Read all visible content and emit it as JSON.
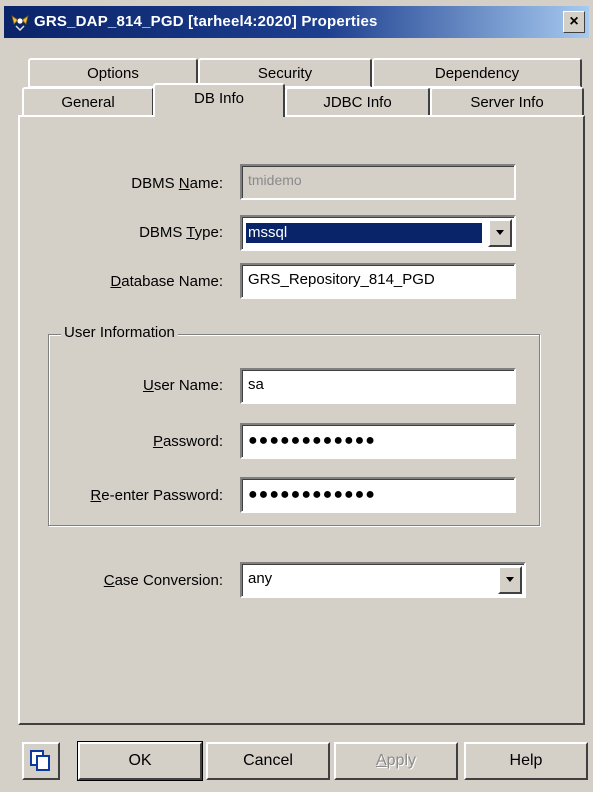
{
  "window": {
    "title": "GRS_DAP_814_PGD [tarheel4:2020] Properties",
    "close_glyph": "×"
  },
  "tabs_back": [
    {
      "label": "Options"
    },
    {
      "label": "Security"
    },
    {
      "label": "Dependency"
    }
  ],
  "tabs_front": [
    {
      "label": "General"
    },
    {
      "label": "DB Info",
      "active": true
    },
    {
      "label": "JDBC Info"
    },
    {
      "label": "Server Info"
    }
  ],
  "form": {
    "dbms_name": {
      "label_pre": "DBMS ",
      "label_u": "N",
      "label_post": "ame:",
      "value": "tmidemo"
    },
    "dbms_type": {
      "label_pre": "DBMS ",
      "label_u": "T",
      "label_post": "ype:",
      "value": "mssql"
    },
    "database_name": {
      "label_pre": "",
      "label_u": "D",
      "label_post": "atabase Name:",
      "value": "GRS_Repository_814_PGD"
    },
    "user_info_title": "User Information",
    "user_name": {
      "label_pre": "",
      "label_u": "U",
      "label_post": "ser Name:",
      "value": "sa"
    },
    "password": {
      "label_pre": "",
      "label_u": "P",
      "label_post": "assword:",
      "value": "●●●●●●●●●●●●"
    },
    "reenter_password": {
      "label_pre": "",
      "label_u": "R",
      "label_post": "e-enter Password:",
      "value": "●●●●●●●●●●●●"
    },
    "case_conversion": {
      "label_pre": "",
      "label_u": "C",
      "label_post": "ase Conversion:",
      "value": "any"
    }
  },
  "buttons": {
    "ok": "OK",
    "cancel": "Cancel",
    "apply_u": "A",
    "apply_post": "pply",
    "help": "Help"
  },
  "colors": {
    "face": "#d4d0c8",
    "title_start": "#0a246a",
    "title_end": "#a6caf0",
    "selection": "#0a246a"
  },
  "icons": {
    "title_icon": "properties-icon",
    "copy_icon": "copy-icon",
    "dropdown": "chevron-down-icon"
  }
}
